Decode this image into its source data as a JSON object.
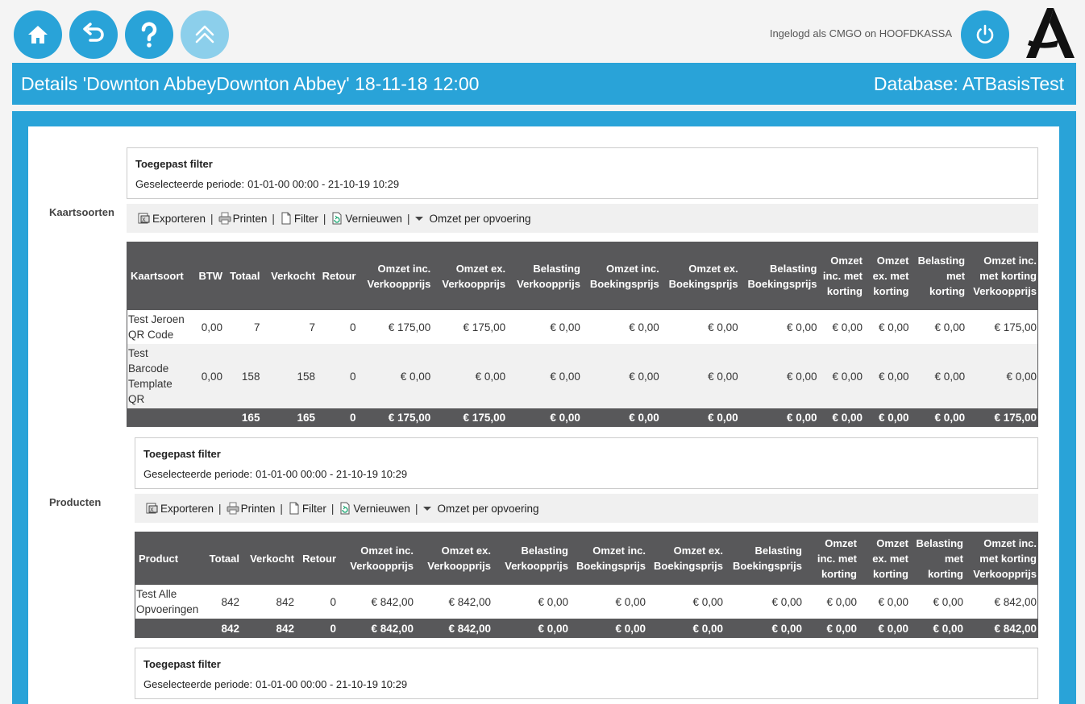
{
  "header": {
    "login_text": "Ingelogd als CMGO on HOOFDKASSA",
    "title": "Details 'Downton AbbeyDownton Abbey' 18-11-18 12:00",
    "database": "Database: ATBasisTest"
  },
  "colors": {
    "accent": "#29a3d8",
    "table_header": "#58585a"
  },
  "icons": [
    "home-icon",
    "back-icon",
    "help-icon",
    "scroll-top-icon",
    "power-icon"
  ],
  "filter": {
    "title": "Toegepast filter",
    "period_label": "Geselecteerde periode:",
    "period_value": "01-01-00 00:00 - 21-10-19 10:29"
  },
  "toolbar": {
    "export": "Exporteren",
    "print": "Printen",
    "filter": "Filter",
    "refresh": "Vernieuwen",
    "dropdown": "Omzet per opvoering",
    "sep": "|"
  },
  "kaartsoorten": {
    "label": "Kaartsoorten",
    "headers": [
      "Kaartsoort",
      "BTW",
      "Totaal",
      "Verkocht",
      "Retour",
      "Omzet inc. Verkoopprijs",
      "Omzet ex. Verkoopprijs",
      "Belasting Verkoopprijs",
      "Omzet inc. Boekingsprijs",
      "Omzet ex. Boekingsprijs",
      "Belasting Boekingsprijs",
      "Omzet inc. met korting",
      "Omzet ex. met korting",
      "Belasting met korting",
      "Omzet inc. met korting Verkoopprijs"
    ],
    "rows": [
      [
        "Test Jeroen QR Code",
        "0,00",
        "7",
        "7",
        "0",
        "€ 175,00",
        "€ 175,00",
        "€ 0,00",
        "€ 0,00",
        "€ 0,00",
        "€ 0,00",
        "€ 0,00",
        "€ 0,00",
        "€ 0,00",
        "€ 175,00"
      ],
      [
        "Test Barcode Template QR",
        "0,00",
        "158",
        "158",
        "0",
        "€ 0,00",
        "€ 0,00",
        "€ 0,00",
        "€ 0,00",
        "€ 0,00",
        "€ 0,00",
        "€ 0,00",
        "€ 0,00",
        "€ 0,00",
        "€ 0,00"
      ]
    ],
    "totals": [
      "",
      "",
      "165",
      "165",
      "0",
      "€ 175,00",
      "€ 175,00",
      "€ 0,00",
      "€ 0,00",
      "€ 0,00",
      "€ 0,00",
      "€ 0,00",
      "€ 0,00",
      "€ 0,00",
      "€ 175,00"
    ]
  },
  "producten": {
    "label": "Producten",
    "headers": [
      "Product",
      "Totaal",
      "Verkocht",
      "Retour",
      "Omzet inc. Verkoopprijs",
      "Omzet ex. Verkoopprijs",
      "Belasting Verkoopprijs",
      "Omzet inc. Boekingsprijs",
      "Omzet ex. Boekingsprijs",
      "Belasting Boekingsprijs",
      "Omzet inc. met korting",
      "Omzet ex. met korting",
      "Belasting met korting",
      "Omzet inc. met korting Verkoopprijs"
    ],
    "rows": [
      [
        "Test Alle Opvoeringen",
        "842",
        "842",
        "0",
        "€ 842,00",
        "€ 842,00",
        "€ 0,00",
        "€ 0,00",
        "€ 0,00",
        "€ 0,00",
        "€ 0,00",
        "€ 0,00",
        "€ 0,00",
        "€ 842,00"
      ]
    ],
    "totals": [
      "",
      "842",
      "842",
      "0",
      "€ 842,00",
      "€ 842,00",
      "€ 0,00",
      "€ 0,00",
      "€ 0,00",
      "€ 0,00",
      "€ 0,00",
      "€ 0,00",
      "€ 0,00",
      "€ 842,00"
    ]
  }
}
